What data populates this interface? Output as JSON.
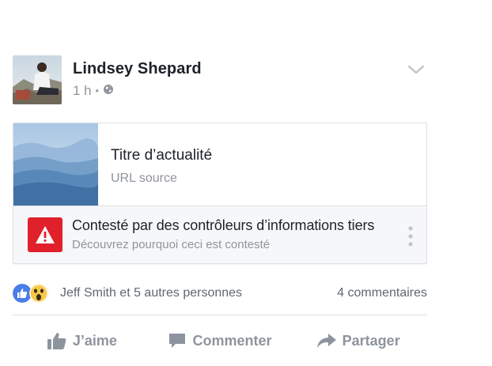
{
  "post": {
    "author": "Lindsey Shepard",
    "time": "1 h",
    "separator": "•",
    "privacy_icon": "globe-icon",
    "menu_icon": "chevron-down-icon"
  },
  "link_card": {
    "title": "Titre d’actualité",
    "source": "URL source",
    "dispute_title": "Contesté par des contrôleurs d’informations tiers",
    "dispute_subtitle": "Découvrez pourquoi ceci est contesté",
    "warning_icon": "warning-icon",
    "more_icon": "more-vertical-icon",
    "warning_color": "#e0202a"
  },
  "reactions": {
    "icons": [
      "like-reaction-icon",
      "wow-reaction-icon"
    ],
    "names": "Jeff Smith et 5 autres personnes",
    "comments": "4 commentaires"
  },
  "actions": {
    "like": "J’aime",
    "comment": "Commenter",
    "share": "Partager"
  },
  "colors": {
    "accent": "#4267b2",
    "muted": "#90949c",
    "text": "#1d2129"
  }
}
